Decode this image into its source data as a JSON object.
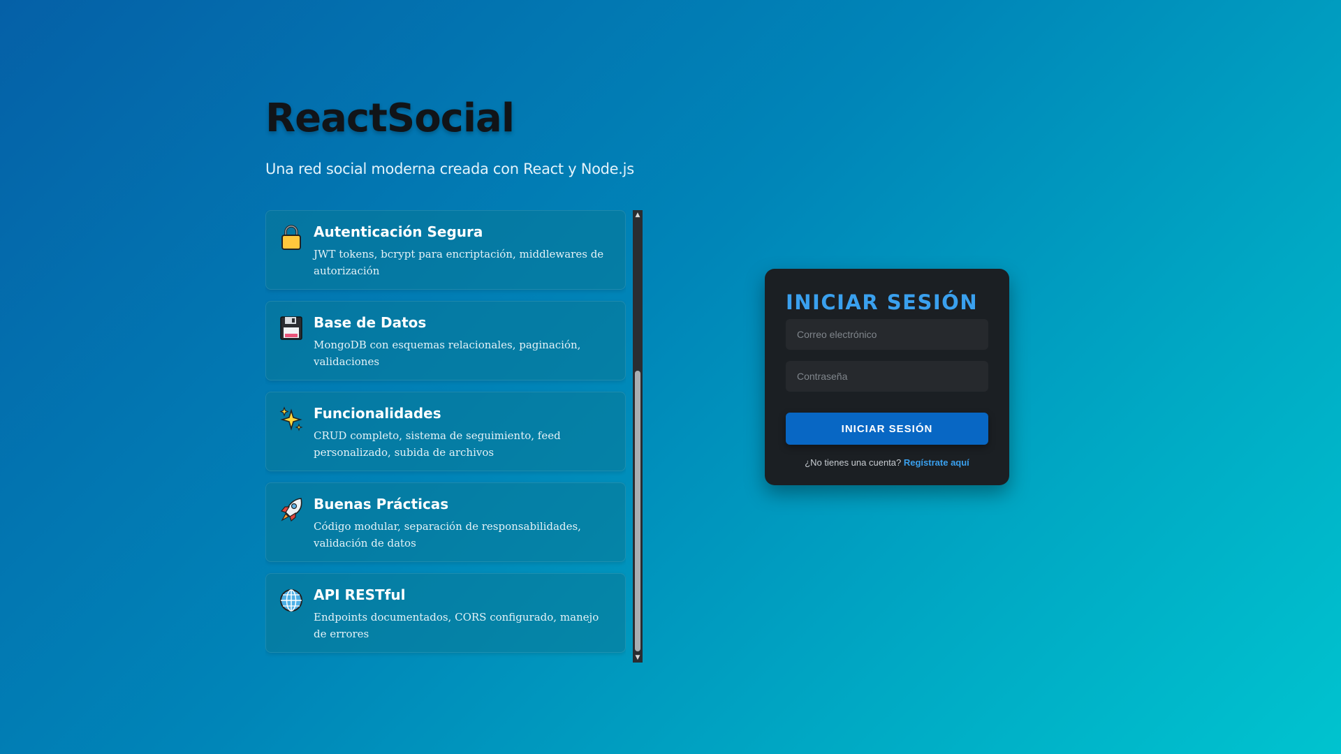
{
  "brand": {
    "title": "ReactSocial",
    "subtitle": "Una red social moderna creada con React y Node.js"
  },
  "features": [
    {
      "icon": "lock-icon",
      "title": "Autenticación Segura",
      "description": "JWT tokens, bcrypt para encriptación, middlewares de autorización"
    },
    {
      "icon": "floppy-disk-icon",
      "title": "Base de Datos",
      "description": "MongoDB con esquemas relacionales, paginación, validaciones"
    },
    {
      "icon": "sparkles-icon",
      "title": "Funcionalidades",
      "description": "CRUD completo, sistema de seguimiento, feed personalizado, subida de archivos"
    },
    {
      "icon": "rocket-icon",
      "title": "Buenas Prácticas",
      "description": "Código modular, separación de responsabilidades, validación de datos"
    },
    {
      "icon": "globe-icon",
      "title": "API RESTful",
      "description": "Endpoints documentados, CORS configurado, manejo de errores"
    }
  ],
  "login": {
    "title": "INICIAR SESIÓN",
    "email_placeholder": "Correo electrónico",
    "email_value": "",
    "password_placeholder": "Contraseña",
    "password_value": "",
    "submit_label": "INICIAR SESIÓN",
    "register_prompt": "¿No tienes una cuenta?",
    "register_link": "Regístrate aquí"
  },
  "colors": {
    "accent": "#3aa0ee",
    "button": "#0867c4",
    "card_bg": "#1b1f23"
  }
}
